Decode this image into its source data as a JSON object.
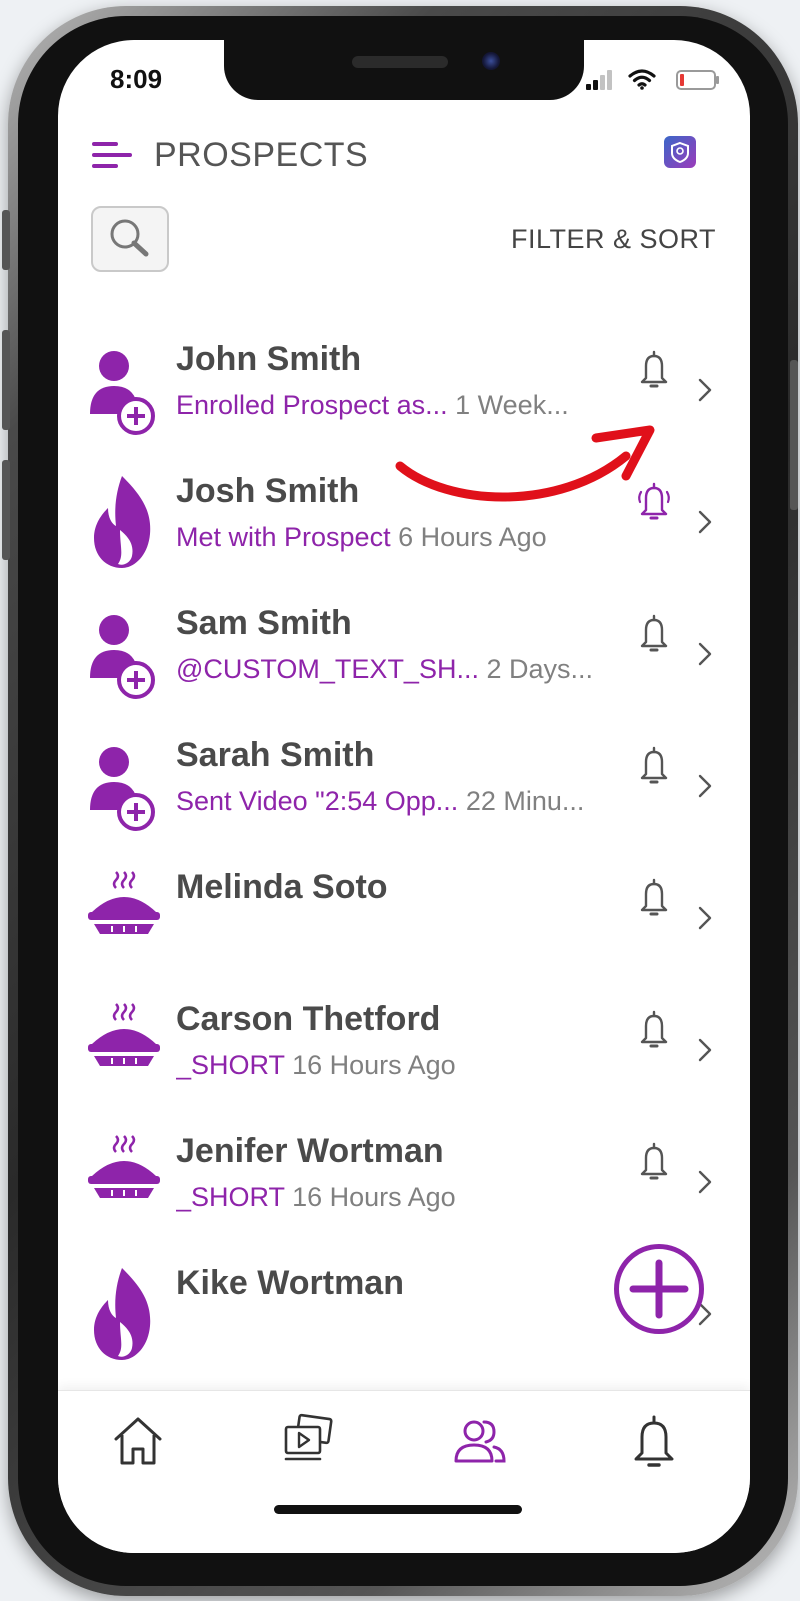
{
  "status_bar": {
    "time": "8:09"
  },
  "header": {
    "title": "PROSPECTS",
    "filter_sort_label": "FILTER & SORT"
  },
  "colors": {
    "accent": "#8e24aa",
    "arrow": "#e0101a",
    "name_text": "#4a4a4a",
    "time_text": "#808080"
  },
  "prospects": [
    {
      "name": "John Smith",
      "avatar": "person-add-icon",
      "activity": "Enrolled Prospect as...",
      "time": "1 Week...",
      "bell_active": false
    },
    {
      "name": "Josh Smith",
      "avatar": "flame-icon",
      "activity": "Met with Prospect",
      "time": "6 Hours Ago",
      "bell_active": true
    },
    {
      "name": "Sam Smith",
      "avatar": "person-add-icon",
      "activity": "@CUSTOM_TEXT_SH...",
      "time": "2 Days...",
      "bell_active": false
    },
    {
      "name": "Sarah Smith",
      "avatar": "person-add-icon",
      "activity": "Sent Video \"2:54 Opp...",
      "time": "22 Minu...",
      "bell_active": false
    },
    {
      "name": "Melinda Soto",
      "avatar": "pie-icon",
      "activity": "",
      "time": "",
      "bell_active": false
    },
    {
      "name": "Carson Thetford",
      "avatar": "pie-icon",
      "activity": "_SHORT",
      "time": "16 Hours Ago",
      "bell_active": false
    },
    {
      "name": "Jenifer Wortman",
      "avatar": "pie-icon",
      "activity": "_SHORT",
      "time": "16 Hours Ago",
      "bell_active": false
    },
    {
      "name": "Kike Wortman",
      "avatar": "flame-icon",
      "activity": "",
      "time": "",
      "bell_active": false
    }
  ],
  "tab_bar": [
    {
      "icon": "home-icon",
      "active": false
    },
    {
      "icon": "media-library-icon",
      "active": false
    },
    {
      "icon": "people-icon",
      "active": true
    },
    {
      "icon": "bell-icon",
      "active": false
    }
  ]
}
